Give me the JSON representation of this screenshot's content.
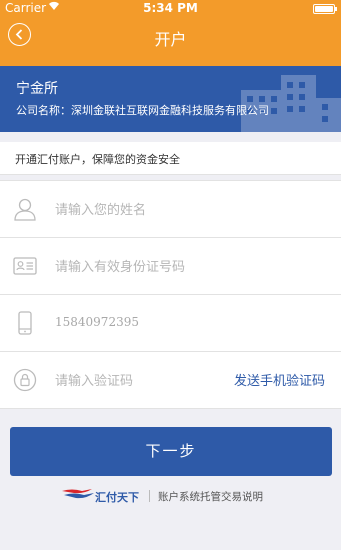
{
  "status_bar": {
    "carrier": "Carrier",
    "time": "5:34 PM"
  },
  "nav": {
    "title": "开户"
  },
  "banner": {
    "name": "宁金所",
    "company": "公司名称：深圳金联社互联网金融科技服务有限公司"
  },
  "notice": "开通汇付账户，保障您的资金安全",
  "form": {
    "name_placeholder": "请输入您的姓名",
    "id_placeholder": "请输入有效身份证号码",
    "phone_value": "15840972395",
    "code_placeholder": "请输入验证码",
    "send_code_label": "发送手机验证码"
  },
  "next_button": "下一步",
  "footer": {
    "brand": "汇付天下",
    "description": "账户系统托管交易说明"
  },
  "colors": {
    "header": "#f39b2a",
    "primary": "#2e5aa8"
  }
}
